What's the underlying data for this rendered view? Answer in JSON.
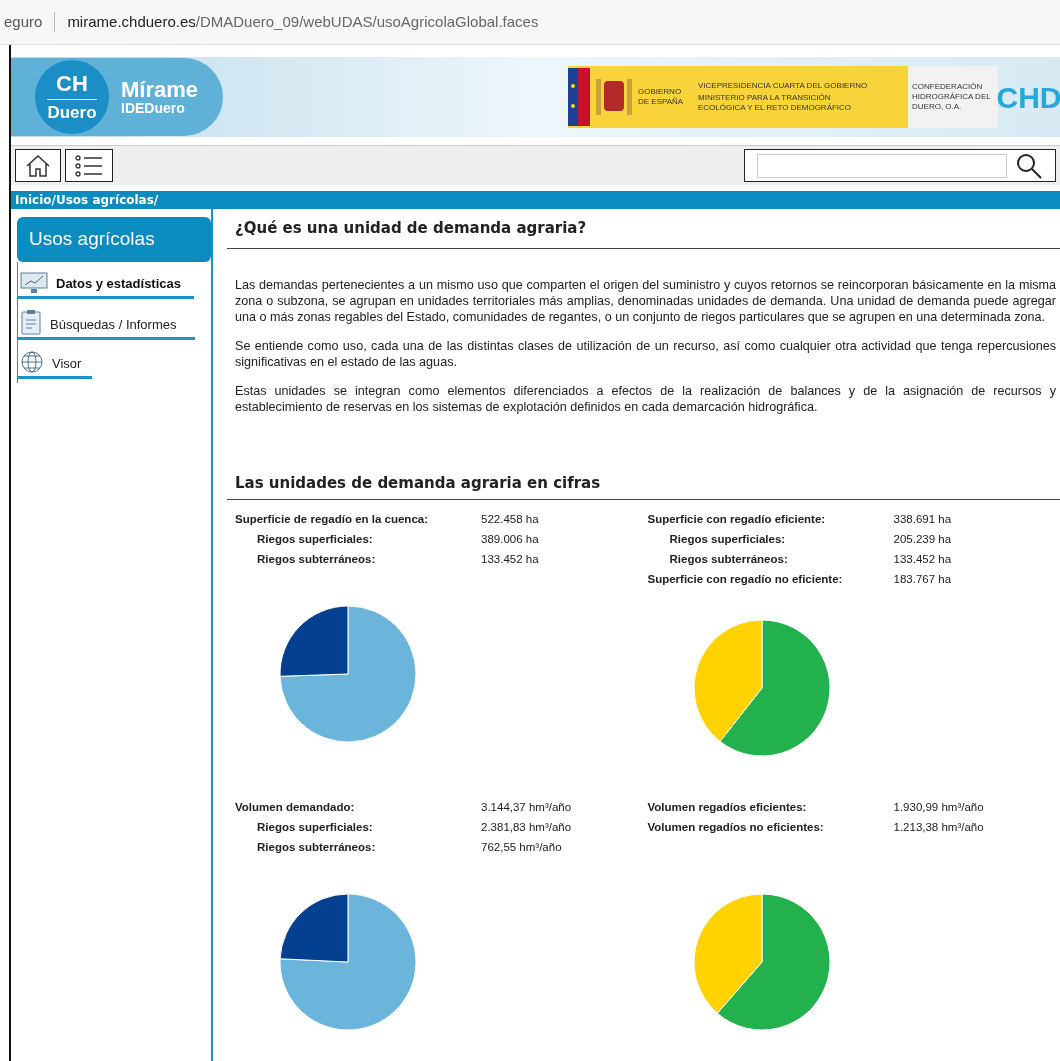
{
  "address_bar": {
    "security": "eguro",
    "host": "mirame.chduero.es",
    "path": "/DMADuero_09/webUDAS/usoAgricolaGlobal.faces"
  },
  "header": {
    "logo_top": "CH",
    "logo_bottom": "Duero",
    "brand": "Mírame",
    "brand_sub": "IDEDuero",
    "gov": "GOBIERNO DE ESPAÑA",
    "vice": "VICEPRESIDENCIA CUARTA DEL GOBIERNO",
    "ministry": "MINISTERIO PARA LA TRANSICIÓN ECOLÓGICA Y EL RETO DEMOGRÁFICO",
    "confed": "CONFEDERACIÓN HIDROGRÁFICA DEL DUERO, O.A.",
    "chd": "CHD"
  },
  "breadcrumb": "Inicio/Usos agrícolas/",
  "sidebar": {
    "title": "Usos agrícolas",
    "items": [
      {
        "label": "Datos y estadísticas",
        "kind": "chart",
        "selected": true
      },
      {
        "label": "Búsquedas / Informes",
        "kind": "clipboard",
        "selected": false
      },
      {
        "label": "Visor",
        "kind": "globe",
        "selected": false
      }
    ]
  },
  "intro": {
    "title": "¿Qué es una unidad de demanda agraria?",
    "paragraphs": [
      "Las demandas pertenecientes a un mismo uso que comparten el origen del suministro y cuyos retornos se reincorporan básicamente en la misma zona o subzona, se agrupan en unidades territoriales más amplias, denominadas unidades de demanda. Una unidad de demanda puede agregar una o más zonas regables del Estado, comunidades de regantes, o un conjunto de riegos particulares que se agrupen en una determinada zona.",
      "Se entiende como uso, cada una de las distintas clases de utilización de un recurso, así como cualquier otra actividad que tenga repercusiones significativas en el estado de las aguas.",
      "Estas unidades se integran como elementos diferenciados a efectos de la realización de balances y de la asignación de recursos y establecimiento de reservas en los sistemas de explotación definidos en cada demarcación hidrográfica."
    ]
  },
  "figures": {
    "title": "Las unidades de demanda agraria en cifras",
    "blocks": [
      {
        "rows": [
          {
            "label": "Superficie de regadío en la cuenca:",
            "value": "522.458 ha",
            "kind": "main"
          },
          {
            "label": "Riegos superficiales:",
            "value": "389.006 ha",
            "kind": "sub"
          },
          {
            "label": "Riegos subterráneos:",
            "value": "133.452 ha",
            "kind": "sub"
          }
        ],
        "chart_data": {
          "type": "pie",
          "values": [
            74.46,
            25.54
          ],
          "colors": [
            "#6bb5dd",
            "#053f8f"
          ]
        }
      },
      {
        "rows": [
          {
            "label": "Superficie con regadío eficiente:",
            "value": "338.691 ha",
            "kind": "main"
          },
          {
            "label": "Riegos superficiales:",
            "value": "205.239 ha",
            "kind": "sub"
          },
          {
            "label": "Riegos subterráneos:",
            "value": "133.452 ha",
            "kind": "sub"
          },
          {
            "label": "Superficie con regadío no eficiente:",
            "value": "183.767 ha",
            "kind": "main"
          }
        ],
        "chart_data": {
          "type": "pie",
          "values": [
            60.6,
            39.4
          ],
          "colors": [
            "#22b14c",
            "#ffd200"
          ]
        }
      },
      {
        "rows": [
          {
            "label": "Volumen demandado:",
            "value": "3.144,37 hm³/año",
            "kind": "main"
          },
          {
            "label": "Riegos superficiales:",
            "value": "2.381,83 hm³/año",
            "kind": "sub"
          },
          {
            "label": "Riegos subterráneos:",
            "value": "762,55 hm³/año",
            "kind": "sub"
          }
        ],
        "chart_data": {
          "type": "pie",
          "values": [
            75.75,
            24.25
          ],
          "colors": [
            "#6bb5dd",
            "#053f8f"
          ]
        }
      },
      {
        "rows": [
          {
            "label": "Volumen regadíos eficientes:",
            "value": "1.930,99 hm³/año",
            "kind": "main"
          },
          {
            "label": "Volumen regadíos no eficientes:",
            "value": "1.213,38 hm³/año",
            "kind": "main"
          }
        ],
        "chart_data": {
          "type": "pie",
          "values": [
            61.41,
            38.59
          ],
          "colors": [
            "#22b14c",
            "#ffd200"
          ]
        }
      }
    ]
  }
}
